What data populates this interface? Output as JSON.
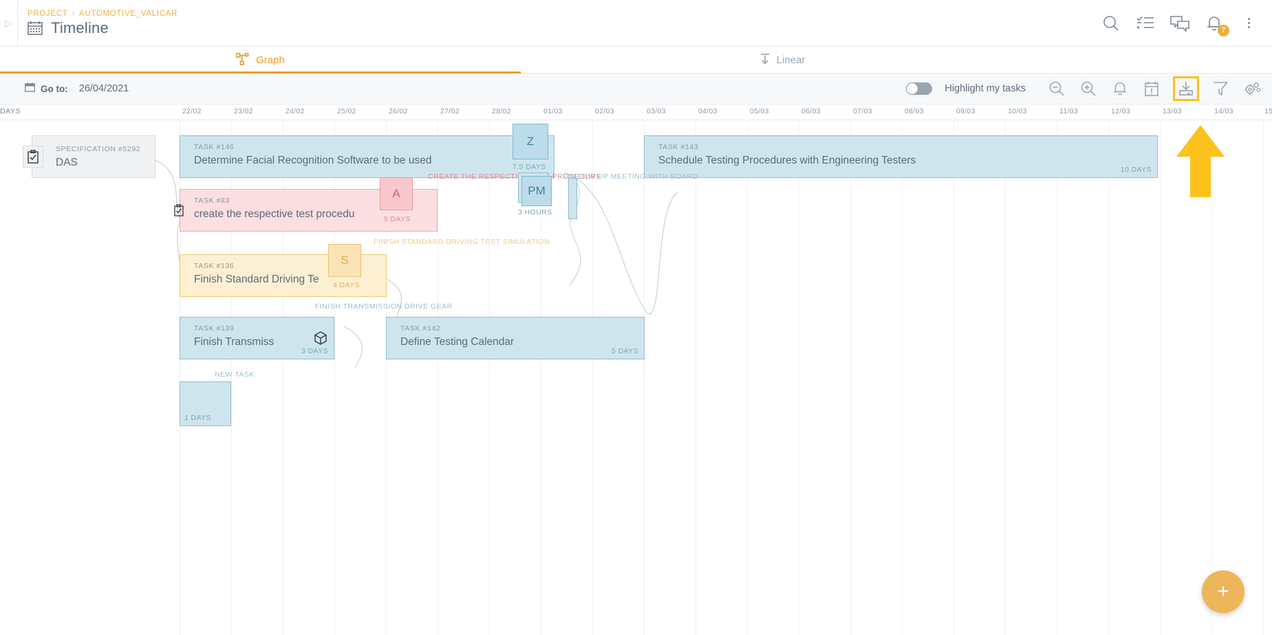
{
  "header": {
    "breadcrumb_root": "PROJECT",
    "breadcrumb_sep": "›",
    "breadcrumb_project": "AUTOMOTIVE_VALICAR",
    "page_title": "Timeline",
    "calendar_icon": "calendar-icon",
    "icons": [
      {
        "name": "search-icon"
      },
      {
        "name": "checklist-icon"
      },
      {
        "name": "chat-icon"
      },
      {
        "name": "notifications-bell-icon",
        "badge": "7"
      },
      {
        "name": "more-options-icon"
      }
    ]
  },
  "tabs": [
    {
      "id": "graph",
      "label": "Graph",
      "icon": "graph-icon",
      "active": true
    },
    {
      "id": "linear",
      "label": "Linear",
      "icon": "download-arrow-icon",
      "active": false
    }
  ],
  "toolbar": {
    "goto_icon": "calendar-small-icon",
    "goto_label": "Go to:",
    "goto_date": "26/04/2021",
    "highlight_label": "Highlight my tasks",
    "highlight_on": false,
    "icons": [
      {
        "name": "zoom-out-icon",
        "highlighted": false
      },
      {
        "name": "zoom-in-icon",
        "highlighted": false
      },
      {
        "name": "alerts-bell-icon",
        "highlighted": false
      },
      {
        "name": "calendar-alert-icon",
        "highlighted": false
      },
      {
        "name": "export-download-icon",
        "highlighted": true
      },
      {
        "name": "filter-icon",
        "highlighted": false
      },
      {
        "name": "settings-gears-icon",
        "highlighted": false
      }
    ]
  },
  "timeline": {
    "unit_label": "DAYS",
    "ticks": [
      "22/02",
      "23/02",
      "24/02",
      "25/02",
      "26/02",
      "27/02",
      "28/02",
      "01/03",
      "02/03",
      "03/03",
      "04/03",
      "05/03",
      "06/03",
      "07/03",
      "08/03",
      "09/03",
      "10/03",
      "11/03",
      "12/03",
      "13/03",
      "14/03",
      "15"
    ]
  },
  "cards": {
    "specification": {
      "sub": "SPECIFICATION #5292",
      "title": "DAS",
      "icon": "clipboard-check-icon"
    },
    "tasks": [
      {
        "id": "t146",
        "sub": "TASK #146",
        "title": "Determine Facial Recognition Software to be used",
        "duration": "7.5 DAYS",
        "color": "blue",
        "avatar": "Z"
      },
      {
        "id": "t143",
        "sub": "TASK #143",
        "title": "Schedule Testing Procedures with Engineering Testers",
        "duration": "10 DAYS",
        "color": "blue",
        "avatar": ""
      },
      {
        "id": "t83",
        "sub": "TASK #83",
        "title": "create the respective test procedu",
        "duration": "5 DAYS",
        "color": "pink",
        "avatar": "A",
        "icon": "clipboard-check-icon"
      },
      {
        "id": "t136",
        "sub": "TASK #136",
        "title": "Finish Standard Driving Te",
        "duration": "4 DAYS",
        "color": "amber",
        "avatar": "S"
      },
      {
        "id": "t139",
        "sub": "TASK #139",
        "title": "Finish Transmiss",
        "duration": "3 DAYS",
        "color": "blue",
        "icon": "cube-icon"
      },
      {
        "id": "t142",
        "sub": "TASK #142",
        "title": "Define Testing Calendar",
        "duration": "5 DAYS",
        "color": "blue"
      },
      {
        "id": "tnew",
        "sub": "",
        "title": "",
        "duration": "1 DAYS",
        "color": "blue"
      }
    ],
    "milestone": {
      "avatar": "PM",
      "duration": "3 HOURS",
      "color": "blue"
    },
    "connector_labels": [
      {
        "text": "CREATE THE RESPECTIVE TEST PROCEDURE",
        "color": "pink"
      },
      {
        "text": "FOLLOW UP MEETING WITH BOARD",
        "color": "blue"
      },
      {
        "text": "FINISH STANDARD DRIVING TEST SIMULATION",
        "color": "amber"
      },
      {
        "text": "FINISH TRANSMISSION DRIVE GEAR",
        "color": "blue"
      },
      {
        "text": "NEW TASK",
        "color": "blue"
      }
    ]
  },
  "fab": {
    "label": "+",
    "icon": "plus-icon"
  },
  "annotation": {
    "name": "highlight-arrow",
    "color": "#fcc21b"
  },
  "colors": {
    "accent": "#ef9d2b",
    "highlight": "#fcc21b",
    "blue_fill": "#cfe5ee",
    "blue_border": "#8fbdd0",
    "pink_fill": "#fbdfe2",
    "pink_border": "#f0a8b0",
    "amber_fill": "#fdf0d2",
    "amber_border": "#efc96b",
    "text": "#5d6a78"
  }
}
